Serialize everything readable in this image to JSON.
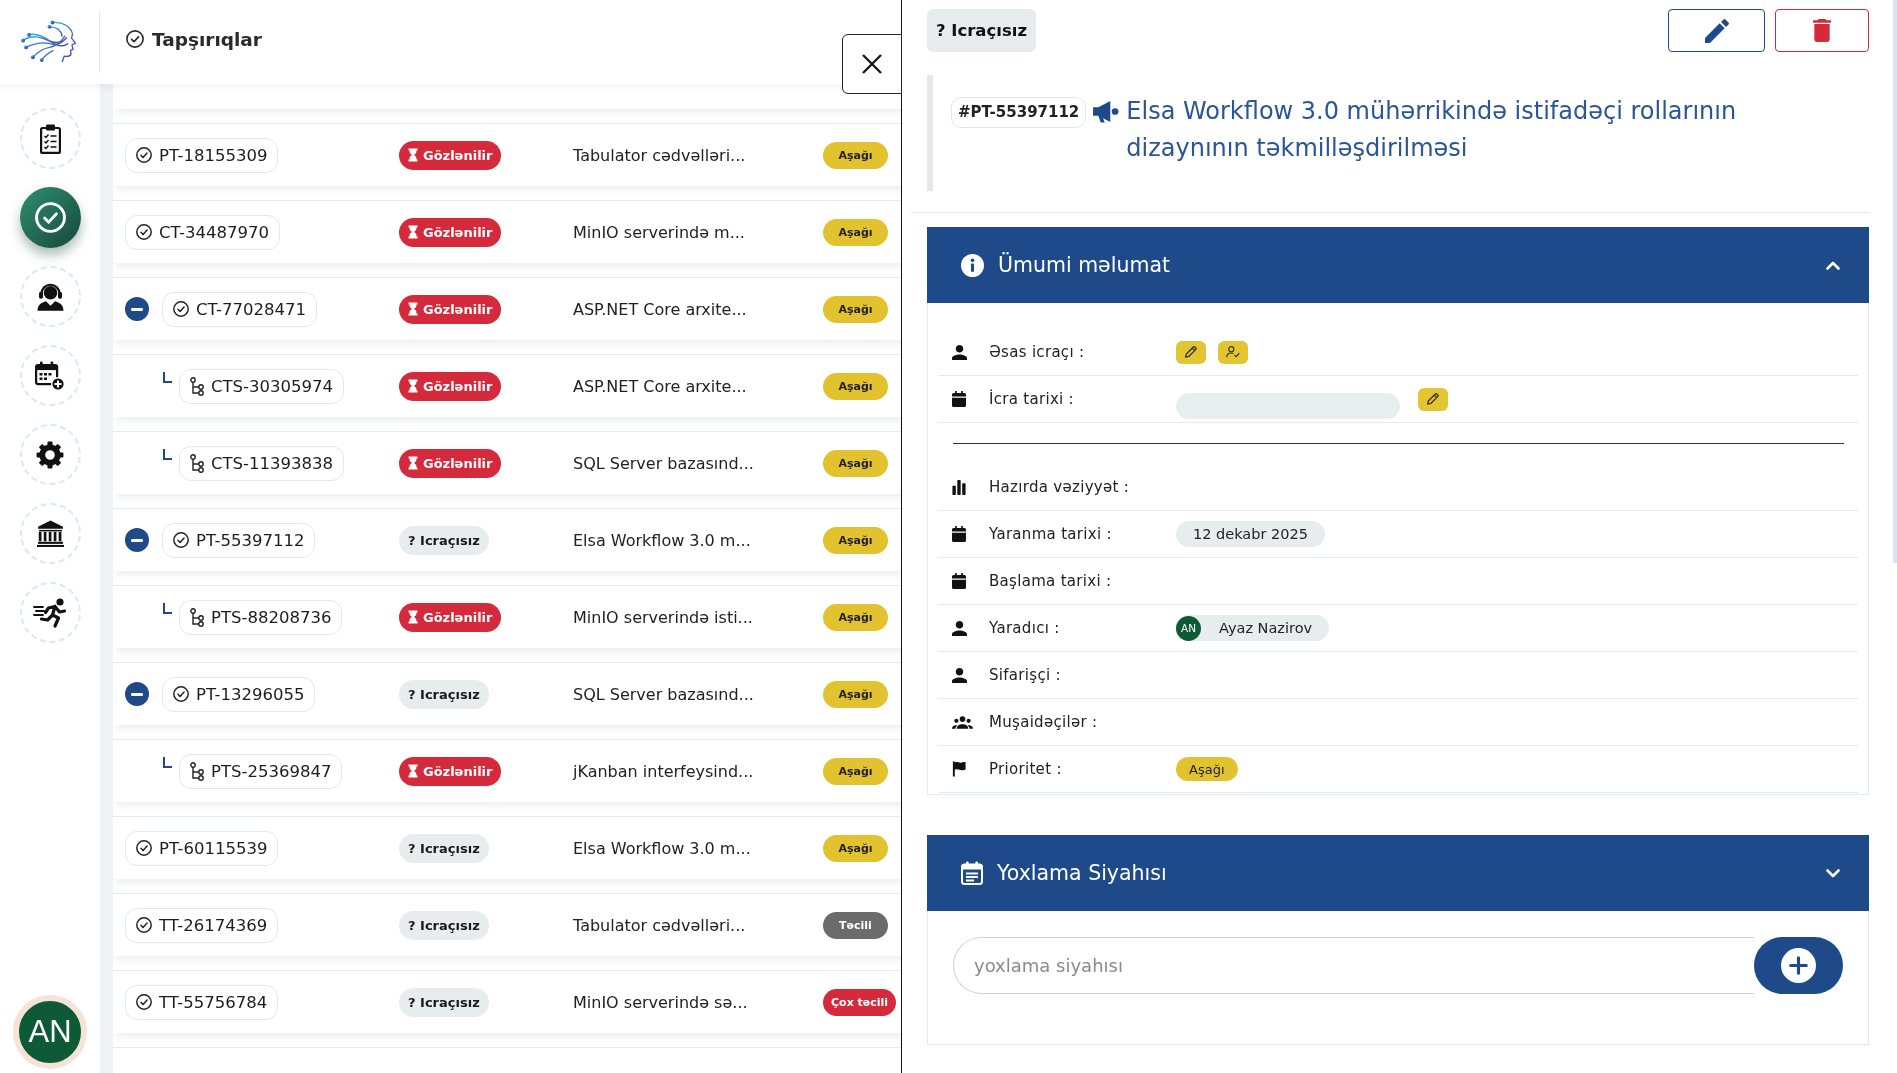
{
  "header": {
    "title": "Tapşırıqlar"
  },
  "sidebar": {
    "items": [
      {
        "selected": false
      },
      {
        "selected": true
      },
      {
        "selected": false
      },
      {
        "selected": false
      },
      {
        "selected": false
      },
      {
        "selected": false
      },
      {
        "selected": false
      }
    ],
    "user": {
      "initials": "AN"
    }
  },
  "tasks": [
    {
      "id": "PT-18155309",
      "status": {
        "kind": "pending",
        "label": "Gözlənilir"
      },
      "title": "Tabulator cədvəlləri...",
      "priority": {
        "kind": "low",
        "label": "Aşağı"
      }
    },
    {
      "id": "CT-34487970",
      "status": {
        "kind": "pending",
        "label": "Gözlənilir"
      },
      "title": "MinIO serverində m...",
      "priority": {
        "kind": "low",
        "label": "Aşağı"
      }
    },
    {
      "id": "CT-77028471",
      "expanded": true,
      "status": {
        "kind": "pending",
        "label": "Gözlənilir"
      },
      "title": "ASP.NET Core arxite...",
      "priority": {
        "kind": "low",
        "label": "Aşağı"
      },
      "children": [
        {
          "id": "CTS-30305974",
          "status": {
            "kind": "pending",
            "label": "Gözlənilir"
          },
          "title": "ASP.NET Core arxite...",
          "priority": {
            "kind": "low",
            "label": "Aşağı"
          }
        },
        {
          "id": "CTS-11393838",
          "status": {
            "kind": "pending",
            "label": "Gözlənilir"
          },
          "title": "SQL Server bazasınd...",
          "priority": {
            "kind": "low",
            "label": "Aşağı"
          }
        }
      ]
    },
    {
      "id": "PT-55397112",
      "expanded": true,
      "status": {
        "kind": "unassigned",
        "label": "? Icraçısız"
      },
      "title": "Elsa Workflow 3.0 m...",
      "priority": {
        "kind": "low",
        "label": "Aşağı"
      },
      "children": [
        {
          "id": "PTS-88208736",
          "status": {
            "kind": "pending",
            "label": "Gözlənilir"
          },
          "title": "MinIO serverində isti...",
          "priority": {
            "kind": "low",
            "label": "Aşağı"
          }
        }
      ]
    },
    {
      "id": "PT-13296055",
      "expanded": true,
      "status": {
        "kind": "unassigned",
        "label": "? Icraçısız"
      },
      "title": "SQL Server bazasınd...",
      "priority": {
        "kind": "low",
        "label": "Aşağı"
      },
      "children": [
        {
          "id": "PTS-25369847",
          "status": {
            "kind": "pending",
            "label": "Gözlənilir"
          },
          "title": "jKanban interfeysind...",
          "priority": {
            "kind": "low",
            "label": "Aşağı"
          }
        }
      ]
    },
    {
      "id": "PT-60115539",
      "status": {
        "kind": "unassigned",
        "label": "? Icraçısız"
      },
      "title": "Elsa Workflow 3.0 m...",
      "priority": {
        "kind": "low",
        "label": "Aşağı"
      }
    },
    {
      "id": "TT-26174369",
      "status": {
        "kind": "unassigned",
        "label": "? Icraçısız"
      },
      "title": "Tabulator cədvəlləri...",
      "priority": {
        "kind": "urgent",
        "label": "Təcili"
      }
    },
    {
      "id": "TT-55756784",
      "status": {
        "kind": "unassigned",
        "label": "? Icraçısız"
      },
      "title": "MinIO serverində sə...",
      "priority": {
        "kind": "critical",
        "label": "Çox təcili"
      }
    }
  ],
  "detail": {
    "status": {
      "kind": "unassigned",
      "label": "? Icraçısız"
    },
    "id": "#PT-55397112",
    "title": "Elsa Workflow 3.0 mühərrikində istifadəçi rollarının dizaynının təkmilləşdirilməsi",
    "info": {
      "title": "Ümumi məlumat",
      "expanded": true,
      "groups": [
        {
          "fields": [
            {
              "label": "Əsas icraçı :",
              "kind": "assign"
            },
            {
              "label": "İcra tarixi :",
              "kind": "date_edit"
            }
          ]
        },
        {
          "fields": [
            {
              "label": "Hazırda vəziyyət :",
              "kind": "empty"
            },
            {
              "label": "Yaranma tarixi :",
              "kind": "chip",
              "value": "12 dekabr 2025"
            },
            {
              "label": "Başlama tarixi :",
              "kind": "empty"
            },
            {
              "label": "Yaradıcı :",
              "kind": "person",
              "initials": "AN",
              "value": "Ayaz Nazirov"
            },
            {
              "label": "Sifarişçi :",
              "kind": "empty"
            },
            {
              "label": "Muşaidəçilər :",
              "kind": "empty"
            },
            {
              "label": "Prioritet :",
              "kind": "priority",
              "priority": {
                "kind": "low",
                "label": "Aşağı"
              }
            }
          ]
        }
      ]
    },
    "checklist": {
      "title": "Yoxlama Siyahısı",
      "expanded": false,
      "placeholder": "yoxlama siyahısı"
    }
  }
}
